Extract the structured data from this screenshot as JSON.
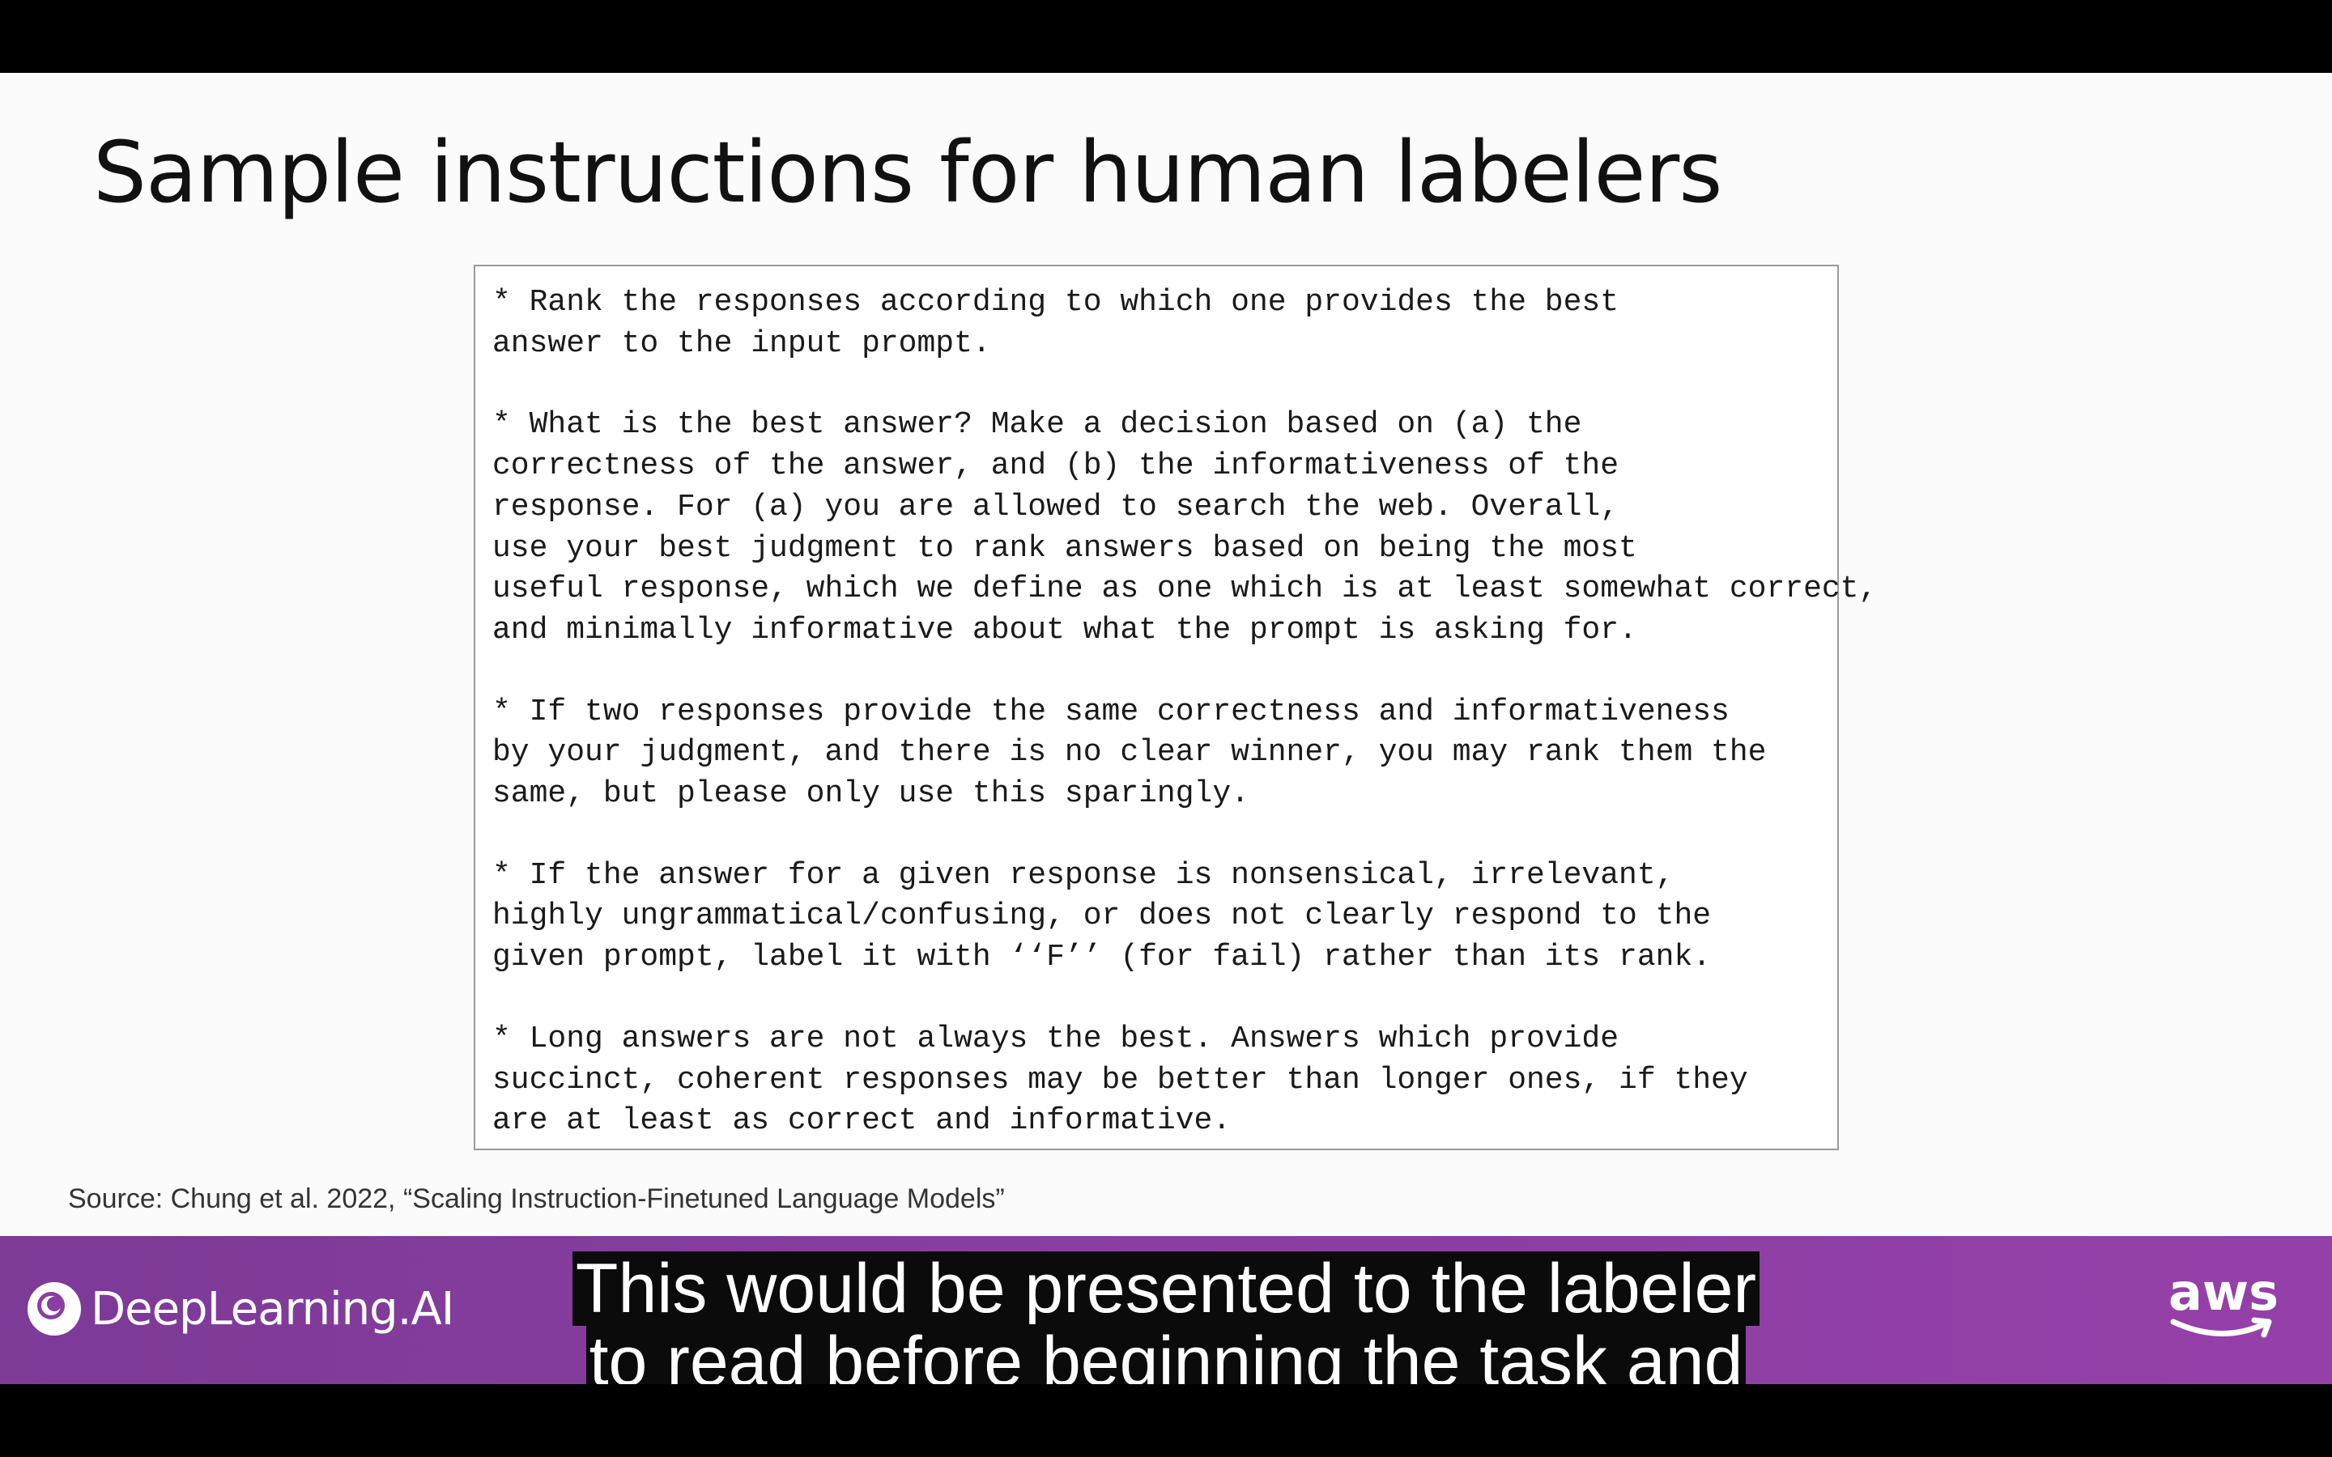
{
  "slide": {
    "title": "Sample instructions for human labelers",
    "instructions": [
      "* Rank the responses according to which one provides the best\nanswer to the input prompt.",
      "* What is the best answer? Make a decision based on (a) the\ncorrectness of the answer, and (b) the informativeness of the\nresponse. For (a) you are allowed to search the web. Overall,\nuse your best judgment to rank answers based on being the most\nuseful response, which we define as one which is at least somewhat correct,\nand minimally informative about what the prompt is asking for.",
      "* If two responses provide the same correctness and informativeness\nby your judgment, and there is no clear winner, you may rank them the\nsame, but please only use this sparingly.",
      "* If the answer for a given response is nonsensical, irrelevant,\nhighly ungrammatical/confusing, or does not clearly respond to the\ngiven prompt, label it with ‘‘F’’ (for fail) rather than its rank.",
      "* Long answers are not always the best. Answers which provide\nsuccinct, coherent responses may be better than longer ones, if they\nare at least as correct and informative."
    ],
    "source": "Source: Chung et al. 2022, “Scaling Instruction-Finetuned Language Models”"
  },
  "banner": {
    "logo_text": "DeepLearning.AI",
    "logo_icon": "deeplearning-ai-logo-icon",
    "aws_text": "aws",
    "aws_icon": "aws-smile-icon",
    "accent_color": "#8a3ea2"
  },
  "subtitles": {
    "line1": "This would be presented to the labeler",
    "line2": "to read before beginning the task and"
  }
}
